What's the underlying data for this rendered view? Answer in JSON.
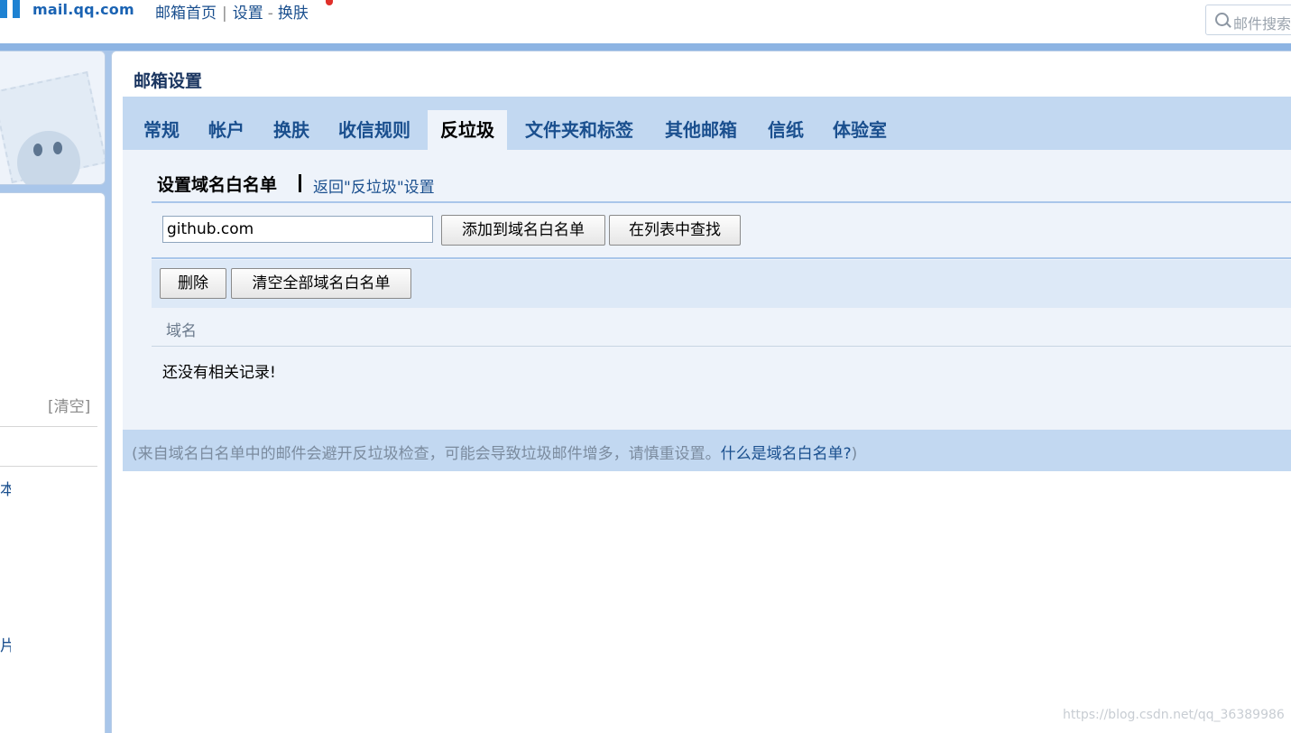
{
  "header": {
    "logo_text": "mail.qq.com",
    "nav": {
      "home": "邮箱首页",
      "separator": "|",
      "settings": "设置",
      "dash": "-",
      "skin": "换肤"
    },
    "search_placeholder": "邮件搜索"
  },
  "sidebar": {
    "clear_link": "[清空]",
    "glyph_1": "本",
    "glyph_2": "片"
  },
  "main": {
    "page_title": "邮箱设置",
    "tabs": [
      {
        "label": "常规",
        "active": false
      },
      {
        "label": "帐户",
        "active": false
      },
      {
        "label": "换肤",
        "active": false
      },
      {
        "label": "收信规则",
        "active": false
      },
      {
        "label": "反垃圾",
        "active": true
      },
      {
        "label": "文件夹和标签",
        "active": false
      },
      {
        "label": "其他邮箱",
        "active": false
      },
      {
        "label": "信纸",
        "active": false
      },
      {
        "label": "体验室",
        "active": false
      }
    ],
    "section_title": "设置域名白名单",
    "back_link": "返回\"反垃圾\"设置",
    "domain_input_value": "github.com",
    "add_button": "添加到域名白名单",
    "find_button": "在列表中查找",
    "delete_button": "删除",
    "clear_all_button": "清空全部域名白名单",
    "column_header": "域名",
    "empty_message": "还没有相关记录!",
    "footer_note": "(来自域名白名单中的邮件会避开反垃圾检查，可能会导致垃圾邮件增多，请慎重设置。",
    "footer_link": "什么是域名白名单?",
    "footer_close": ")"
  },
  "watermark": "https://blog.csdn.net/qq_36389986",
  "colors": {
    "accent_link": "#1a4f8e",
    "tabbar_bg": "#c2d8f1",
    "content_bg": "#eef3fa",
    "frame_bg": "#a9c6ea"
  }
}
